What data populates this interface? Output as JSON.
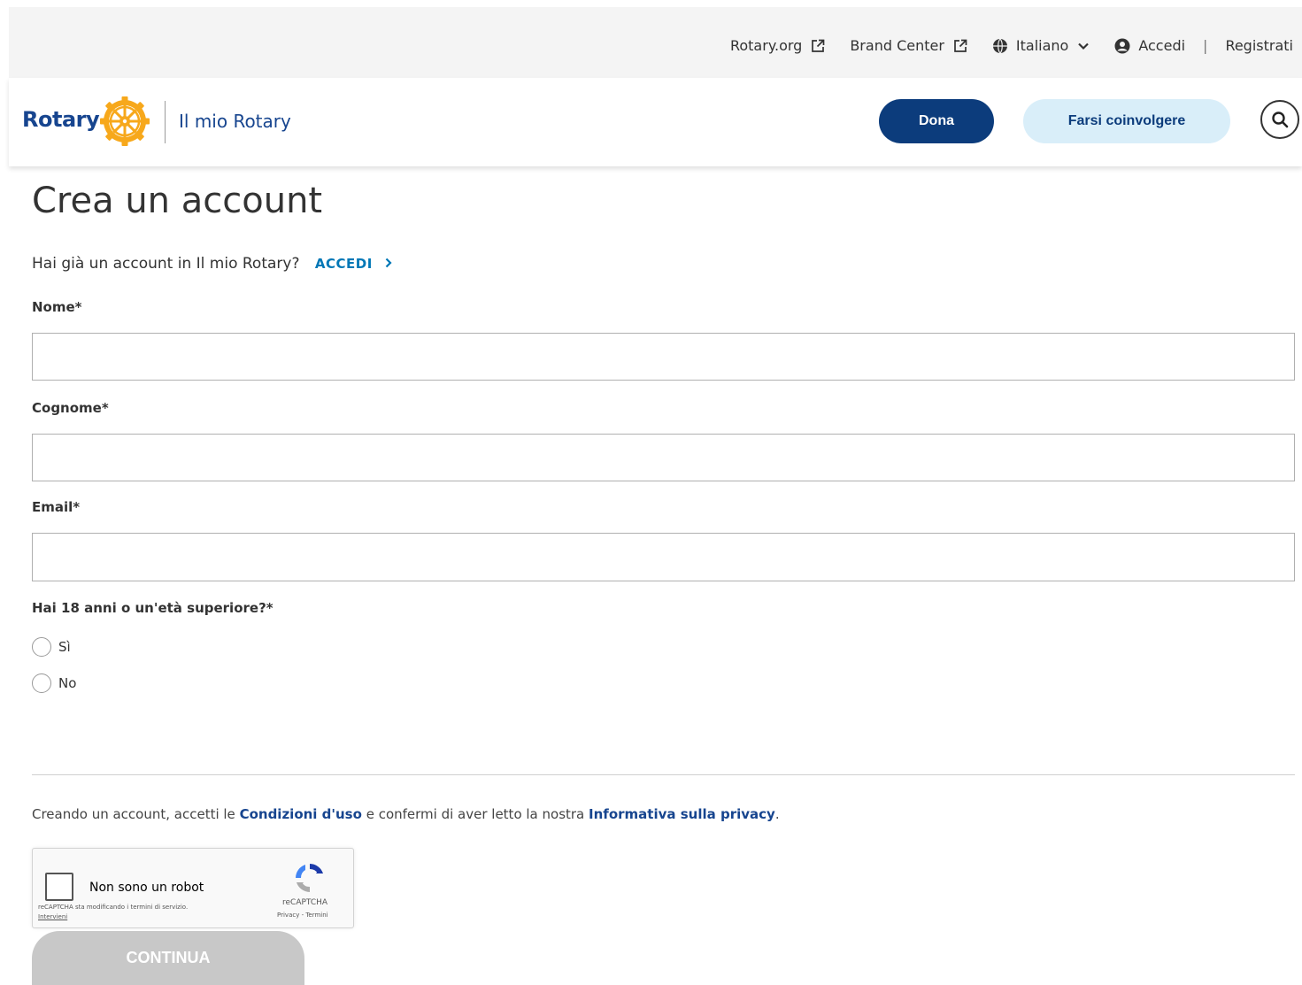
{
  "topbar": {
    "rotary_org": "Rotary.org",
    "brand_center": "Brand Center",
    "language": "Italiano",
    "login": "Accedi",
    "separator": "|",
    "register": "Registrati"
  },
  "header": {
    "logo_text": "Rotary",
    "site_name": "Il mio Rotary",
    "donate_button": "Dona",
    "get_involved_button": "Farsi coinvolgere"
  },
  "form": {
    "title": "Crea un account",
    "already_text": "Hai già un account in Il mio Rotary?",
    "login_link": "ACCEDI",
    "first_name_label": "Nome*",
    "first_name_value": "",
    "last_name_label": "Cognome*",
    "last_name_value": "",
    "email_label": "Email*",
    "email_value": "",
    "age_question": "Hai 18 anni o un'età superiore?*",
    "age_yes": "Sì",
    "age_no": "No",
    "terms_prefix": "Creando un account, accetti le",
    "terms_link": "Condizioni d'uso",
    "terms_middle": "e confermi di aver letto la nostra",
    "privacy_link": "Informativa sulla privacy",
    "terms_suffix": ".",
    "continue_button": "CONTINUA"
  },
  "captcha": {
    "label": "Non sono un robot",
    "notice": "reCAPTCHA sta modificando i termini di servizio.",
    "notice_link": "Intervieni",
    "brand": "reCAPTCHA",
    "privacy_terms": "Privacy - Termini"
  },
  "colors": {
    "brand_blue": "#17458f",
    "donate_bg": "#0c3c7c",
    "involve_bg": "#d9eef9",
    "link_cyan": "#0077b6",
    "disabled_button": "#c8c8c8"
  },
  "icons": [
    "external-link-icon",
    "globe-icon",
    "chevron-down-icon",
    "user-circle-icon",
    "rotary-wheel-icon",
    "search-icon",
    "chevron-right-icon",
    "recaptcha-icon"
  ]
}
